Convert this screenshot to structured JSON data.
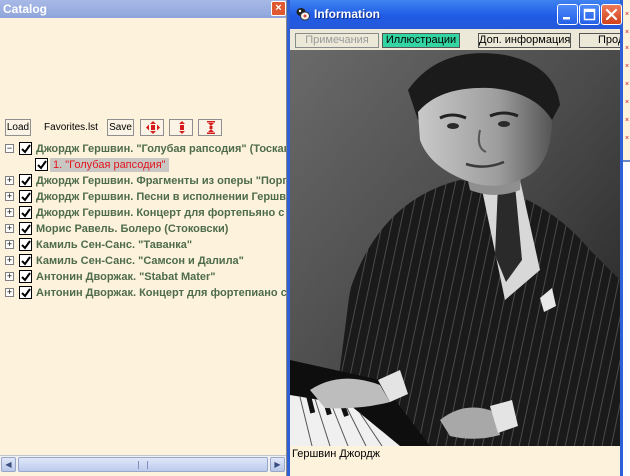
{
  "catalog": {
    "title": "Catalog",
    "toolbar": {
      "load_label": "Load",
      "file_name": "Favorites.lst",
      "save_label": "Save"
    },
    "items": [
      {
        "label": "Джордж Гершвин. \"Голубая рапсодия\" (Тосканини)",
        "expanded": true,
        "checked": true
      },
      {
        "label": "1. \"Голубая рапсодия\"",
        "child": true,
        "checked": true
      },
      {
        "label": "Джордж Гершвин. Фрагменты из оперы \"Порги и Бесс\"",
        "checked": true
      },
      {
        "label": "Джордж Гершвин. Песни в исполнении Гершвина",
        "checked": true
      },
      {
        "label": "Джордж Гершвин. Концерт для фортепьяно с оркестром",
        "checked": true
      },
      {
        "label": "Морис Равель. Болеро (Стоковски)",
        "checked": true
      },
      {
        "label": "Камиль Сен-Санс. \"Таванка\"",
        "checked": true
      },
      {
        "label": "Камиль Сен-Санс. \"Самсон и Далила\"",
        "checked": true
      },
      {
        "label": "Антонин Дворжак. \"Stabat Mater\"",
        "checked": true
      },
      {
        "label": "Антонин Дворжак. Концерт для фортепиано с оркестром",
        "checked": true
      }
    ]
  },
  "info": {
    "title": "Information",
    "tabs": [
      {
        "label": "Примечания",
        "state": "dim"
      },
      {
        "label": "Иллюстрации",
        "state": "active"
      },
      {
        "label": "Доп. информация",
        "state": "normal"
      },
      {
        "label": "Продолжение",
        "state": "normal"
      }
    ],
    "caption": "Гершвин Джордж"
  },
  "colors": {
    "panel_bg": "#fdf2dc",
    "item_text": "#4e6c4a",
    "selected_text": "#e2151d",
    "title_blue": "#1f5be6",
    "active_tab": "#33d6a2"
  }
}
